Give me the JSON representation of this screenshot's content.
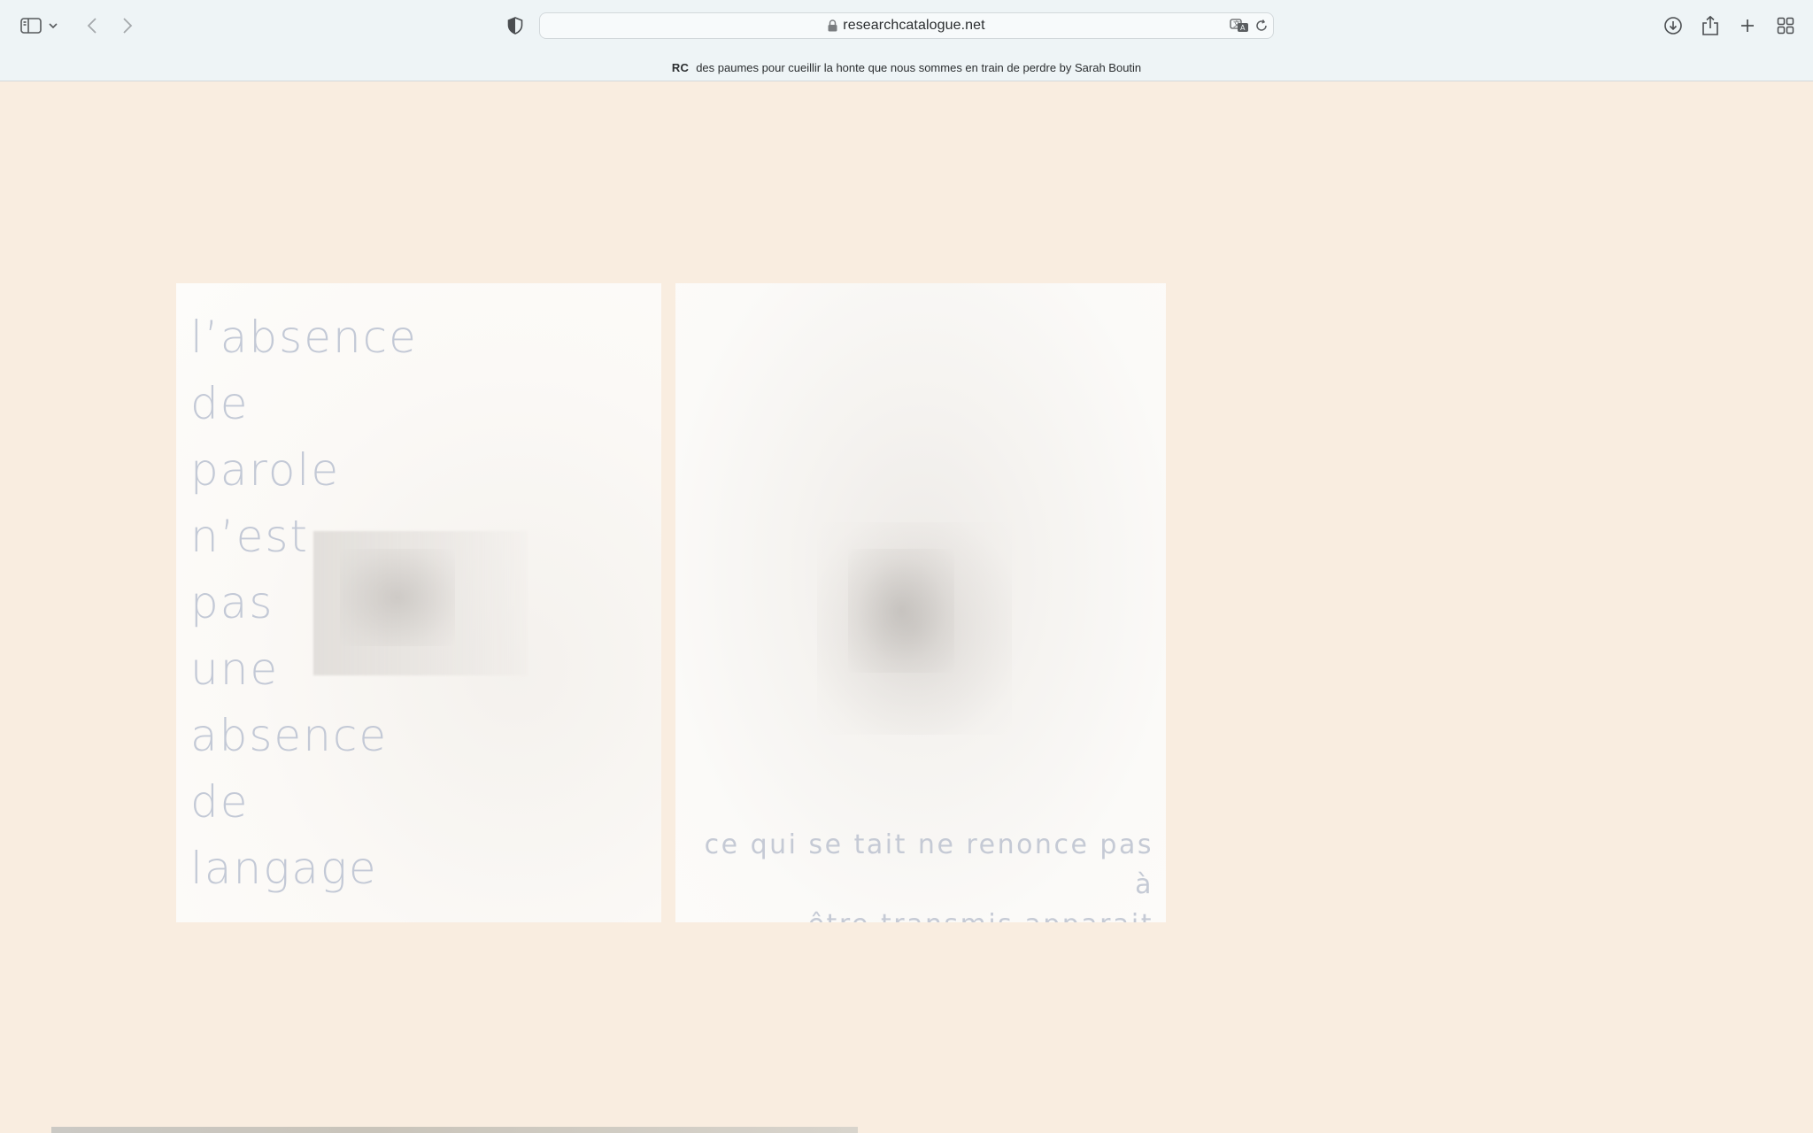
{
  "browser": {
    "url": "researchcatalogue.net",
    "tab": {
      "logo": "RC",
      "title": "des paumes pour cueillir la honte que nous sommes en train de perdre by Sarah Boutin"
    },
    "icons": {
      "sidebar": "sidebar-icon",
      "sidebar_menu": "chevron-down-icon",
      "back": "chevron-left-icon",
      "forward": "chevron-right-icon",
      "privacy": "shield-icon",
      "lock": "lock-icon",
      "translate": "translate-icon",
      "reload": "reload-icon",
      "downloads": "download-icon",
      "share": "share-icon",
      "new_tab": "plus-icon",
      "tab_overview": "grid-icon"
    }
  },
  "content": {
    "left_panel": {
      "lines": [
        "l’absence",
        "de",
        "parole",
        "n’est",
        "pas",
        "une",
        "absence",
        "de",
        "langage"
      ]
    },
    "right_panel": {
      "caption_lines": [
        "ce qui se tait ne renonce pas à",
        "être transmis apparait autrement"
      ]
    }
  },
  "colors": {
    "page_background": "#f9ede0",
    "chrome_background": "#eef4f6",
    "text_pale_blue": "#c3c9d6"
  }
}
